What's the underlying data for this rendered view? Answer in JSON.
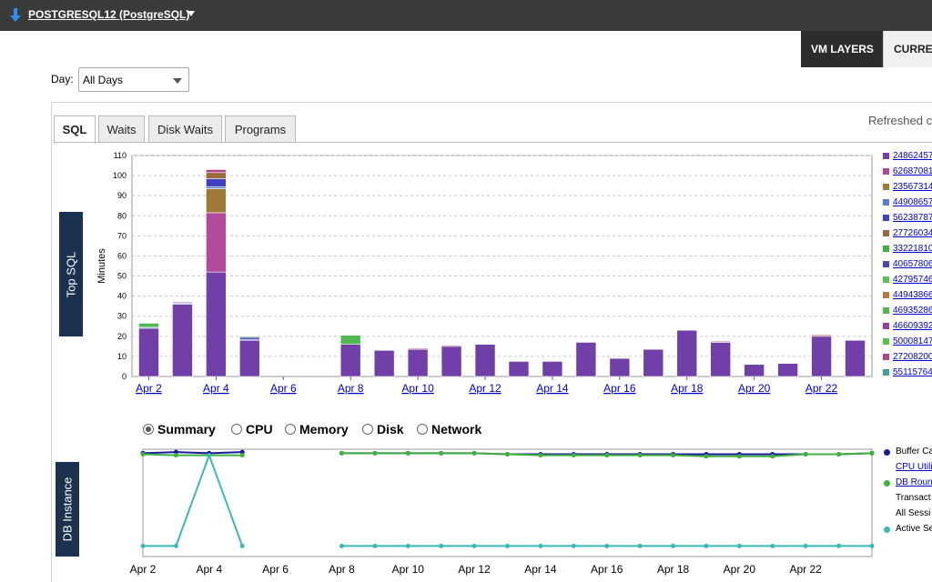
{
  "header": {
    "db_name": "POSTGRESQL12 (PostgreSQL)",
    "icon": "download-arrow-icon",
    "accent": "#2f8ff0"
  },
  "top_tabs": [
    {
      "label": "VM LAYERS",
      "active": true
    },
    {
      "label": "CURRE",
      "active": false
    }
  ],
  "filter": {
    "day_label": "Day:",
    "day_value": "All Days"
  },
  "content_tabs": [
    {
      "label": "SQL",
      "active": true
    },
    {
      "label": "Waits",
      "active": false
    },
    {
      "label": "Disk Waits",
      "active": false
    },
    {
      "label": "Programs",
      "active": false
    }
  ],
  "refreshed_text": "Refreshed c",
  "side_labels": {
    "top_sql": "Top SQL",
    "db_instance": "DB Instance"
  },
  "top_sql_legend": [
    {
      "label": "24862457",
      "color": "#7040a8"
    },
    {
      "label": "62687081",
      "color": "#b04a9a"
    },
    {
      "label": "23567314",
      "color": "#9e7a3a"
    },
    {
      "label": "44908657",
      "color": "#5a7ed0"
    },
    {
      "label": "56238787",
      "color": "#4040c0"
    },
    {
      "label": "27726034",
      "color": "#9a6a3a"
    },
    {
      "label": "33221810",
      "color": "#40b040"
    },
    {
      "label": "40657806",
      "color": "#4848b0"
    },
    {
      "label": "42795746",
      "color": "#58c058"
    },
    {
      "label": "44943866",
      "color": "#b07a40"
    },
    {
      "label": "46935286",
      "color": "#50b850"
    },
    {
      "label": "46609392",
      "color": "#9040a0"
    },
    {
      "label": "50008147",
      "color": "#58c050"
    },
    {
      "label": "27208200",
      "color": "#b04888"
    },
    {
      "label": "55115764",
      "color": "#40a0a0"
    }
  ],
  "radios": [
    {
      "label": "Summary",
      "selected": true
    },
    {
      "label": "CPU",
      "selected": false
    },
    {
      "label": "Memory",
      "selected": false
    },
    {
      "label": "Disk",
      "selected": false
    },
    {
      "label": "Network",
      "selected": false
    }
  ],
  "db_legend": [
    {
      "label": "Buffer Ca",
      "color": "#1a1a9a",
      "link": false
    },
    {
      "label": "CPU Utili",
      "color": "",
      "link": true
    },
    {
      "label": "DB Roun",
      "color": "#40b040",
      "link": true
    },
    {
      "label": "Transact",
      "color": "",
      "link": false
    },
    {
      "label": "All Sessi",
      "color": "",
      "link": false
    },
    {
      "label": "Active Se",
      "color": "#3ab8b8",
      "link": false
    }
  ],
  "chart_data": [
    {
      "type": "bar",
      "stacked": true,
      "ylabel": "Minutes",
      "ylim": [
        0,
        110
      ],
      "yticks": [
        0,
        10,
        20,
        30,
        40,
        50,
        60,
        70,
        80,
        90,
        100,
        110
      ],
      "grid": true,
      "x_tick_labels": [
        "Apr 2",
        "Apr 4",
        "Apr 6",
        "Apr 8",
        "Apr 10",
        "Apr 12",
        "Apr 14",
        "Apr 16",
        "Apr 18",
        "Apr 20",
        "Apr 22"
      ],
      "categories": [
        "Apr 2",
        "Apr 3",
        "Apr 4",
        "Apr 5",
        "Apr 6",
        "Apr 7",
        "Apr 8",
        "Apr 9",
        "Apr 10",
        "Apr 11",
        "Apr 12",
        "Apr 13",
        "Apr 14",
        "Apr 15",
        "Apr 16",
        "Apr 17",
        "Apr 18",
        "Apr 19",
        "Apr 20",
        "Apr 21",
        "Apr 22",
        "Apr 23"
      ],
      "series": [
        {
          "color": "#7040a8",
          "values": [
            24,
            36,
            52,
            18,
            0,
            0,
            16,
            13,
            13.5,
            15,
            16,
            7.5,
            7.5,
            17,
            9,
            13.5,
            23,
            17,
            6,
            6.5,
            20,
            18
          ]
        },
        {
          "color": "#b04a9a",
          "values": [
            0,
            0,
            29.5,
            0,
            0,
            0,
            0,
            0,
            0,
            0,
            0,
            0,
            0,
            0,
            0,
            0,
            0,
            0,
            0,
            0,
            0,
            0
          ]
        },
        {
          "color": "#9e7a3a",
          "values": [
            0,
            0,
            12,
            0,
            0,
            0,
            0,
            0,
            0,
            0,
            0,
            0,
            0,
            0,
            0,
            0,
            0,
            0,
            0,
            0,
            0.5,
            0
          ]
        },
        {
          "color": "#5a7ed0",
          "values": [
            0.5,
            0.5,
            1,
            0.5,
            0,
            0,
            0,
            0,
            0,
            0,
            0,
            0,
            0,
            0,
            0,
            0,
            0,
            0,
            0,
            0,
            0,
            0
          ]
        },
        {
          "color": "#4040c0",
          "values": [
            0,
            0,
            4,
            1,
            0,
            0,
            0,
            0,
            0,
            0,
            0,
            0,
            0,
            0,
            0,
            0,
            0,
            0,
            0,
            0,
            0,
            0
          ]
        },
        {
          "color": "#9a6a3a",
          "values": [
            0,
            0,
            3,
            0,
            0,
            0,
            0,
            0,
            0,
            0,
            0,
            0,
            0,
            0,
            0,
            0,
            0,
            0,
            0,
            0,
            0,
            0
          ]
        },
        {
          "color": "#50b850",
          "values": [
            2,
            0,
            0,
            0.5,
            0,
            0,
            4.5,
            0,
            0,
            0,
            0,
            0,
            0,
            0,
            0,
            0,
            0,
            0,
            0,
            0,
            0,
            0
          ]
        },
        {
          "color": "#b04888",
          "values": [
            0,
            0.5,
            1.5,
            0,
            0,
            0,
            0,
            0,
            0.5,
            0.5,
            0,
            0,
            0,
            0,
            0,
            0,
            0,
            0.5,
            0,
            0,
            0.5,
            0
          ]
        }
      ]
    },
    {
      "type": "line",
      "x_tick_labels": [
        "Apr 2",
        "Apr 4",
        "Apr 6",
        "Apr 8",
        "Apr 10",
        "Apr 12",
        "Apr 14",
        "Apr 16",
        "Apr 18",
        "Apr 20",
        "Apr 22"
      ],
      "x_first": "Apr 2",
      "x_last": "Apr 24",
      "ylim": [
        0,
        100
      ],
      "series": [
        {
          "color": "#1a1a9a",
          "values": [
            98,
            99,
            98,
            99,
            null,
            null,
            98,
            98,
            98,
            98,
            98,
            97,
            97,
            97,
            97,
            97,
            97,
            97,
            97,
            97,
            97,
            97,
            98
          ]
        },
        {
          "color": "#40b040",
          "values": [
            97,
            96,
            96,
            96,
            null,
            null,
            98,
            98,
            98,
            98,
            98,
            97,
            96,
            96,
            96,
            96,
            96,
            95,
            95,
            95,
            97,
            97,
            98
          ]
        },
        {
          "color": "#3ab8b8",
          "values": [
            10,
            10,
            96,
            10,
            null,
            null,
            10,
            10,
            10,
            10,
            10,
            10,
            10,
            10,
            10,
            10,
            10,
            10,
            10,
            10,
            10,
            10,
            10
          ]
        }
      ]
    }
  ]
}
